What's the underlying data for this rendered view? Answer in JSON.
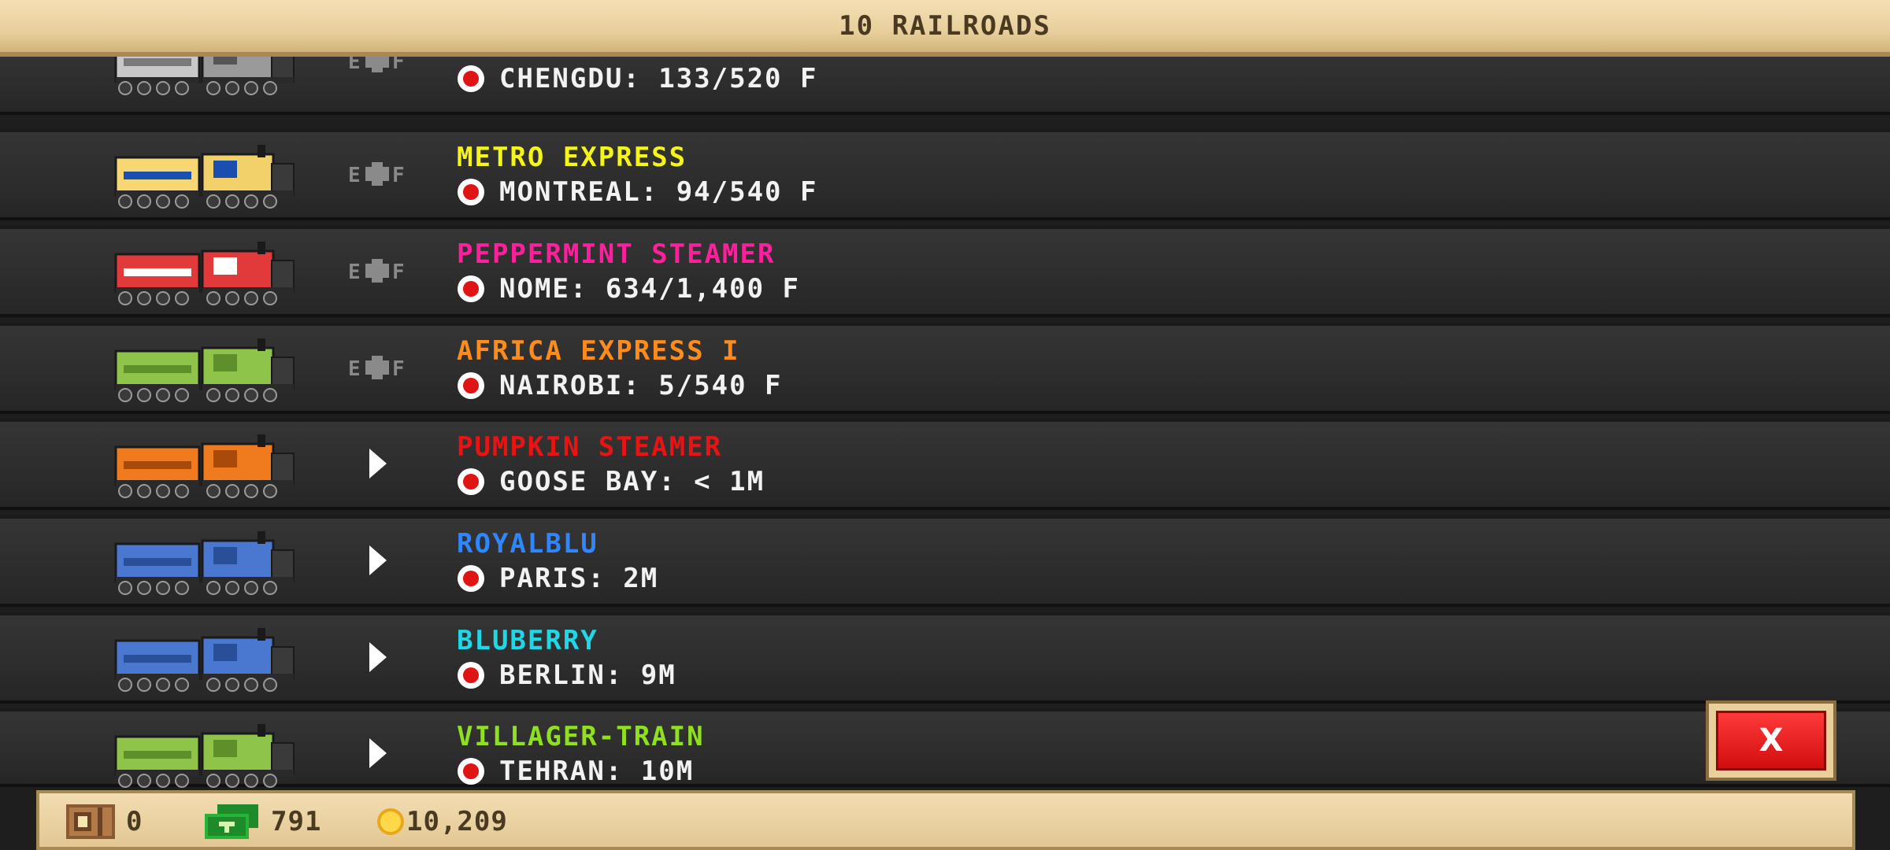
{
  "header": {
    "title": "10 RAILROADS"
  },
  "rows": [
    {
      "name": "",
      "name_color": "#ffffff",
      "destination": "CHENGDU: 133/520 F",
      "status": "cargo",
      "train": "gray-diesel"
    },
    {
      "name": "METRO EXPRESS",
      "name_color": "#f5f51a",
      "destination": "MONTREAL: 94/540 F",
      "status": "cargo",
      "train": "yellow-metro"
    },
    {
      "name": "PEPPERMINT STEAMER",
      "name_color": "#ff1f9c",
      "destination": "NOME: 634/1,400 F",
      "status": "cargo",
      "train": "red-peppermint"
    },
    {
      "name": "AFRICA EXPRESS I",
      "name_color": "#ff8c1a",
      "destination": "NAIROBI: 5/540 F",
      "status": "cargo",
      "train": "green-steam"
    },
    {
      "name": "PUMPKIN STEAMER",
      "name_color": "#e81414",
      "destination": "GOOSE BAY: < 1M",
      "status": "play",
      "train": "orange-pumpkin"
    },
    {
      "name": "ROYALBLU",
      "name_color": "#2f86ff",
      "destination": "PARIS: 2M",
      "status": "play",
      "train": "blue-steam"
    },
    {
      "name": "BLUBERRY",
      "name_color": "#1ed8e8",
      "destination": "BERLIN: 9M",
      "status": "play",
      "train": "blue-steam"
    },
    {
      "name": "VILLAGER-TRAIN",
      "name_color": "#8fe01e",
      "destination": "TEHRAN: 10M",
      "status": "play",
      "train": "green-steam"
    }
  ],
  "close_button": {
    "label": "X"
  },
  "footer": {
    "crates": "0",
    "cash": "791",
    "coins": "10,209"
  },
  "colors": {
    "header_bg": "#e8cf9c",
    "row_bg": "#2e2e2e",
    "close_red": "#e81414"
  }
}
